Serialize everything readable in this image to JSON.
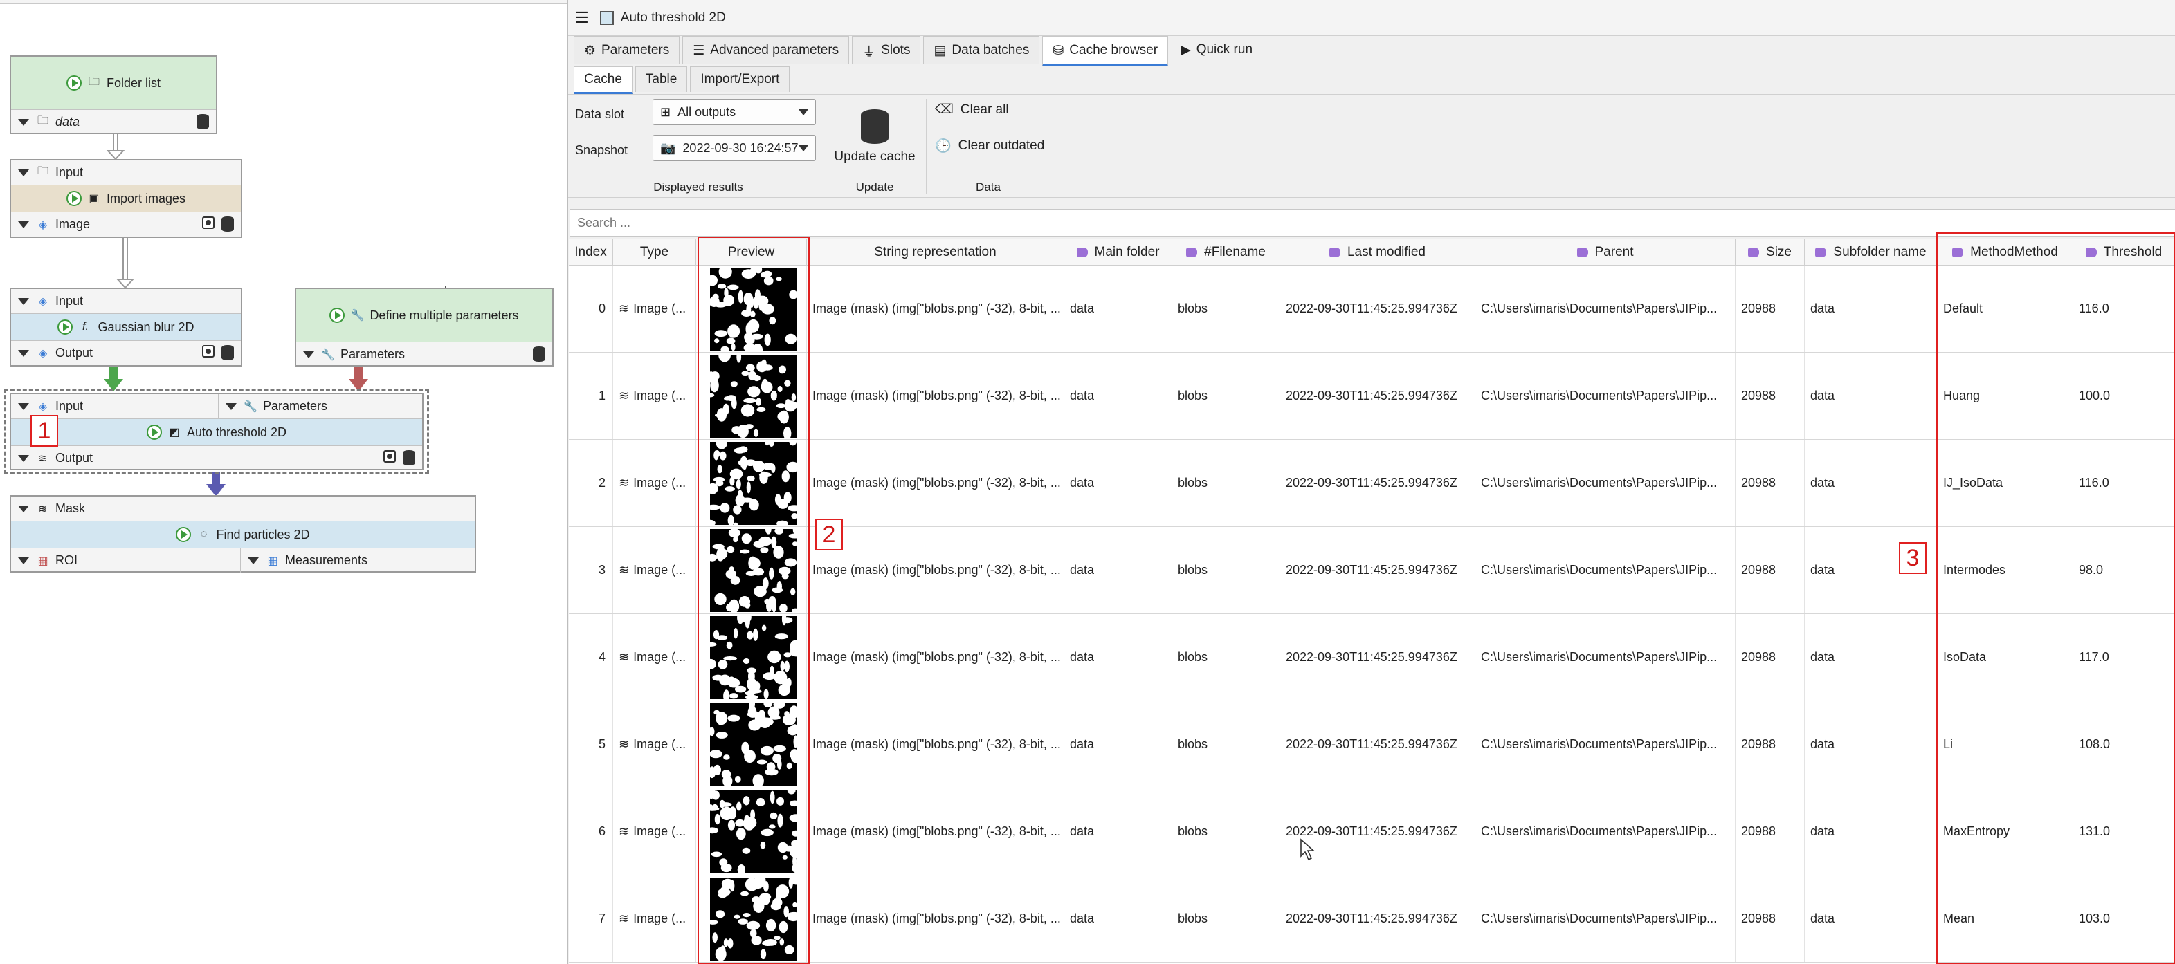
{
  "graph": {
    "nodes": {
      "folder_list": {
        "title": "Folder list",
        "output": "data"
      },
      "import_images": {
        "input": "Input",
        "title": "Import images",
        "output": "Image"
      },
      "gaussian": {
        "input": "Input",
        "title": "Gaussian blur 2D",
        "output": "Output"
      },
      "define_params": {
        "title": "Define multiple parameters",
        "output": "Parameters"
      },
      "auto_threshold": {
        "input": "Input",
        "params_input": "Parameters",
        "title": "Auto threshold 2D",
        "output": "Output"
      },
      "find_particles": {
        "input": "Mask",
        "title": "Find particles 2D",
        "output_roi": "ROI",
        "output_meas": "Measurements"
      }
    },
    "annotation_1": "1"
  },
  "panel": {
    "title": "Auto threshold 2D",
    "tabs": [
      "Parameters",
      "Advanced parameters",
      "Slots",
      "Data batches",
      "Cache browser",
      "Quick run"
    ],
    "active_tab": "Cache browser",
    "subtabs": [
      "Cache",
      "Table",
      "Import/Export"
    ],
    "data_slot_label": "Data slot",
    "data_slot_value": "All outputs",
    "snapshot_label": "Snapshot",
    "snapshot_value": "2022-09-30 16:24:57",
    "displayed_results": "Displayed results",
    "update_cache": "Update cache",
    "update_group": "Update",
    "clear_all": "Clear all",
    "clear_outdated": "Clear outdated",
    "data_group": "Data",
    "search_placeholder": "Search ..."
  },
  "table": {
    "columns": [
      "Index",
      "Type",
      "Preview",
      "String representation",
      "Main folder",
      "#Filename",
      "Last modified",
      "Parent",
      "Size",
      "Subfolder name",
      "MethodMethod",
      "Threshold"
    ],
    "rows": [
      {
        "index": "0",
        "type": "Image (...",
        "string": "Image (mask) (img[\"blobs.png\" (-32), 8-bit, ...",
        "main": "data",
        "file": "blobs",
        "modified": "2022-09-30T11:45:25.994736Z",
        "parent": "C:\\Users\\imaris\\Documents\\Papers\\JIPip...",
        "size": "20988",
        "sub": "data",
        "method": "Default",
        "threshold": "116.0"
      },
      {
        "index": "1",
        "type": "Image (...",
        "string": "Image (mask) (img[\"blobs.png\" (-32), 8-bit, ...",
        "main": "data",
        "file": "blobs",
        "modified": "2022-09-30T11:45:25.994736Z",
        "parent": "C:\\Users\\imaris\\Documents\\Papers\\JIPip...",
        "size": "20988",
        "sub": "data",
        "method": "Huang",
        "threshold": "100.0"
      },
      {
        "index": "2",
        "type": "Image (...",
        "string": "Image (mask) (img[\"blobs.png\" (-32), 8-bit, ...",
        "main": "data",
        "file": "blobs",
        "modified": "2022-09-30T11:45:25.994736Z",
        "parent": "C:\\Users\\imaris\\Documents\\Papers\\JIPip...",
        "size": "20988",
        "sub": "data",
        "method": "IJ_IsoData",
        "threshold": "116.0"
      },
      {
        "index": "3",
        "type": "Image (...",
        "string": "Image (mask) (img[\"blobs.png\" (-32), 8-bit, ...",
        "main": "data",
        "file": "blobs",
        "modified": "2022-09-30T11:45:25.994736Z",
        "parent": "C:\\Users\\imaris\\Documents\\Papers\\JIPip...",
        "size": "20988",
        "sub": "data",
        "method": "Intermodes",
        "threshold": "98.0"
      },
      {
        "index": "4",
        "type": "Image (...",
        "string": "Image (mask) (img[\"blobs.png\" (-32), 8-bit, ...",
        "main": "data",
        "file": "blobs",
        "modified": "2022-09-30T11:45:25.994736Z",
        "parent": "C:\\Users\\imaris\\Documents\\Papers\\JIPip...",
        "size": "20988",
        "sub": "data",
        "method": "IsoData",
        "threshold": "117.0"
      },
      {
        "index": "5",
        "type": "Image (...",
        "string": "Image (mask) (img[\"blobs.png\" (-32), 8-bit, ...",
        "main": "data",
        "file": "blobs",
        "modified": "2022-09-30T11:45:25.994736Z",
        "parent": "C:\\Users\\imaris\\Documents\\Papers\\JIPip...",
        "size": "20988",
        "sub": "data",
        "method": "Li",
        "threshold": "108.0"
      },
      {
        "index": "6",
        "type": "Image (...",
        "string": "Image (mask) (img[\"blobs.png\" (-32), 8-bit, ...",
        "main": "data",
        "file": "blobs",
        "modified": "2022-09-30T11:45:25.994736Z",
        "parent": "C:\\Users\\imaris\\Documents\\Papers\\JIPip...",
        "size": "20988",
        "sub": "data",
        "method": "MaxEntropy",
        "threshold": "131.0"
      },
      {
        "index": "7",
        "type": "Image (...",
        "string": "Image (mask) (img[\"blobs.png\" (-32), 8-bit, ...",
        "main": "data",
        "file": "blobs",
        "modified": "2022-09-30T11:45:25.994736Z",
        "parent": "C:\\Users\\imaris\\Documents\\Papers\\JIPip...",
        "size": "20988",
        "sub": "data",
        "method": "Mean",
        "threshold": "103.0"
      }
    ]
  },
  "annotations": {
    "label_2": "2",
    "label_3": "3"
  },
  "colors": {
    "annotation_red": "#e02020",
    "node_green": "#d5ecd5",
    "node_tan": "#e8dfcc",
    "node_blue": "#d3e6f1",
    "tag_purple": "#9b6fd6"
  }
}
